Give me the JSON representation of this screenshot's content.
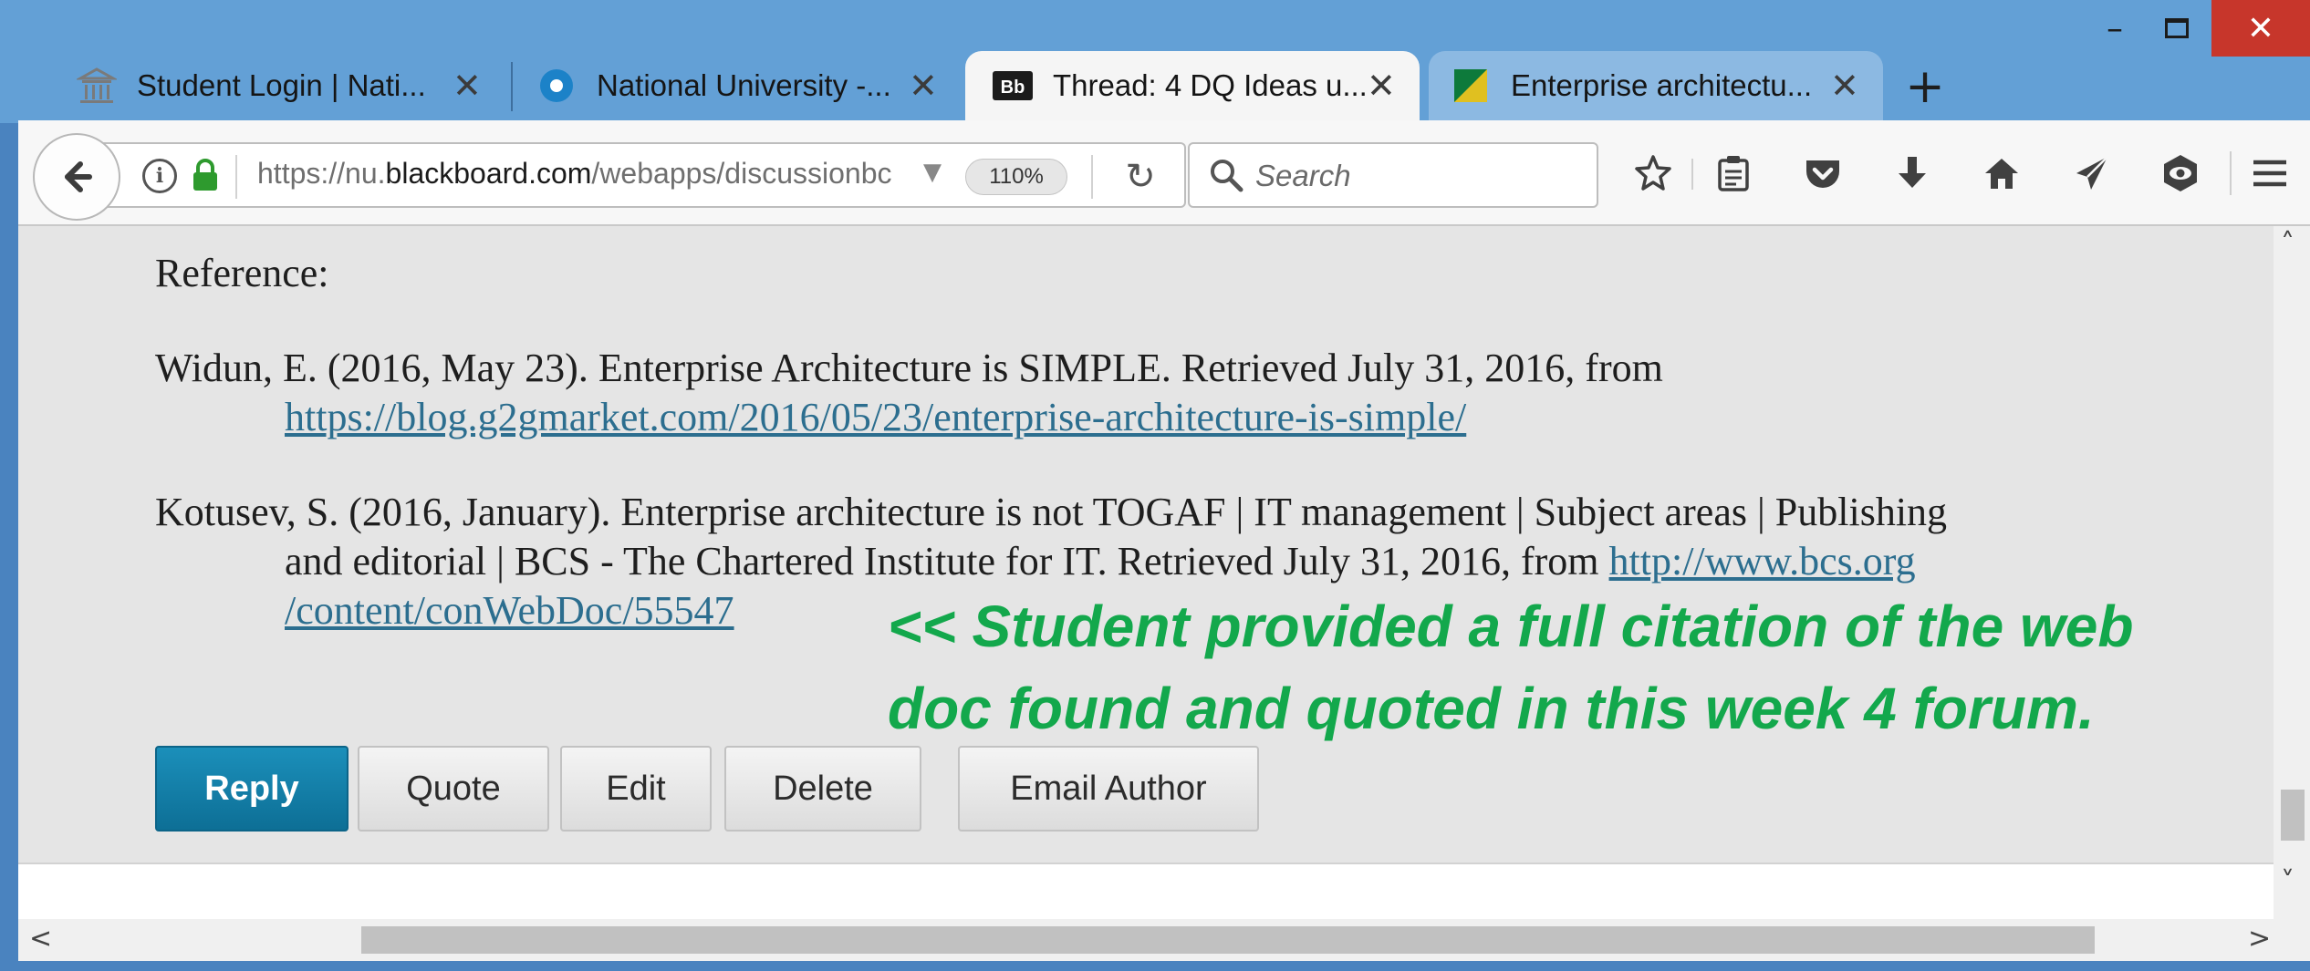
{
  "window": {
    "minimize": "–",
    "close": "✕"
  },
  "tabs": [
    {
      "title": "Student Login | Nati...",
      "icon": "university-icon",
      "active": false
    },
    {
      "title": "National University -...",
      "icon": "circle-icon",
      "active": false
    },
    {
      "title": "Thread: 4 DQ Ideas u...",
      "icon": "blackboard-bb-icon",
      "active": true
    },
    {
      "title": "Enterprise architectu...",
      "icon": "bcs-icon",
      "active": false
    }
  ],
  "tab_close": "✕",
  "new_tab": "+",
  "nav": {
    "url_prefix": "https://nu.",
    "url_domain": "blackboard.com",
    "url_path": "/webapps/discussionbc",
    "zoom": "110%",
    "reload": "↻",
    "search_placeholder": "Search"
  },
  "post": {
    "reference_heading": "Reference:",
    "ref1_text": "Widun, E. (2016, May 23). Enterprise Architecture is SIMPLE. Retrieved July 31, 2016, from",
    "ref1_link": "https://blog.g2gmarket.com/2016/05/23/enterprise-architecture-is-simple/",
    "ref2_line1": "Kotusev, S. (2016, January). Enterprise architecture is not TOGAF | IT management | Subject areas | Publishing",
    "ref2_line2": "and editorial | BCS - The Chartered Institute for IT. Retrieved July 31, 2016, from ",
    "ref2_link_a": "http://www.bcs.org",
    "ref2_link_b": "/content/conWebDoc/55547",
    "note_line1": "<< Student provided a full citation of the web",
    "note_line2": "doc found and quoted in this week 4 forum."
  },
  "buttons": {
    "reply": "Reply",
    "quote": "Quote",
    "edit": "Edit",
    "delete": "Delete",
    "email_author": "Email Author"
  },
  "scroll": {
    "up": "˄",
    "down": "˅",
    "left": "<",
    "right": ">"
  },
  "colors": {
    "titlebar": "#63a0d6",
    "reply_button": "#0d6f96",
    "note": "#13a84c",
    "link": "#2c6e8f"
  }
}
